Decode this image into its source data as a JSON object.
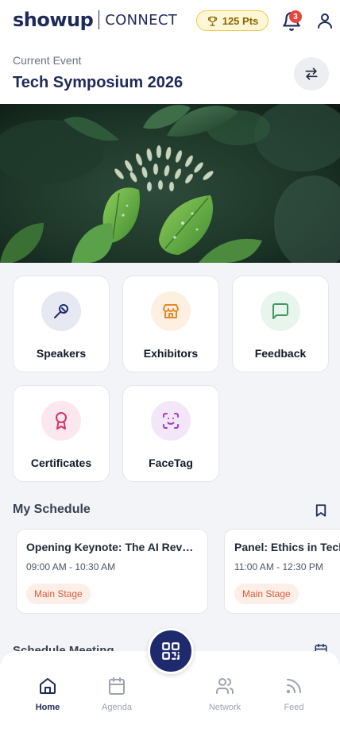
{
  "header": {
    "logo_word": "showup",
    "logo_sub": "CONNECT",
    "points": "125 Pts",
    "notification_count": "3",
    "icons": [
      "trophy-icon",
      "bell-icon",
      "user-icon"
    ]
  },
  "event": {
    "label": "Current Event",
    "title": "Tech Symposium 2026",
    "switch_icon": "swap-icon"
  },
  "tiles": [
    {
      "label": "Speakers",
      "icon": "microphone-icon",
      "bg": "#e6e8f2",
      "color": "#1e2a6e"
    },
    {
      "label": "Exhibitors",
      "icon": "store-icon",
      "bg": "#fdf0e1",
      "color": "#e8892b"
    },
    {
      "label": "Feedback",
      "icon": "message-square-icon",
      "bg": "#e8f5ec",
      "color": "#3c9a5f"
    },
    {
      "label": "Certificates",
      "icon": "award-icon",
      "bg": "#fde7ee",
      "color": "#d6336c"
    },
    {
      "label": "FaceTag",
      "icon": "face-scan-icon",
      "bg": "#f2e6f8",
      "color": "#9b3dc4"
    }
  ],
  "schedule": {
    "title": "My Schedule",
    "items": [
      {
        "title": "Opening Keynote: The AI Revolution",
        "time": "09:00 AM - 10:30 AM",
        "location": "Main Stage"
      },
      {
        "title": "Panel: Ethics in Tech",
        "time": "11:00 AM - 12:30 PM",
        "location": "Main Stage"
      }
    ]
  },
  "meeting": {
    "title": "Schedule Meeting"
  },
  "nav": {
    "items": [
      {
        "label": "Home",
        "icon": "home-icon",
        "active": true
      },
      {
        "label": "Agenda",
        "icon": "calendar-icon",
        "active": false
      },
      {
        "label": "Network",
        "icon": "users-icon",
        "active": false
      },
      {
        "label": "Feed",
        "icon": "rss-icon",
        "active": false
      }
    ],
    "center_icon": "qr-code-icon"
  },
  "colors": {
    "brand": "#1e2a5a",
    "accent": "#e11d48",
    "tag_bg": "#fdeee8",
    "tag_text": "#dc5b3c"
  }
}
